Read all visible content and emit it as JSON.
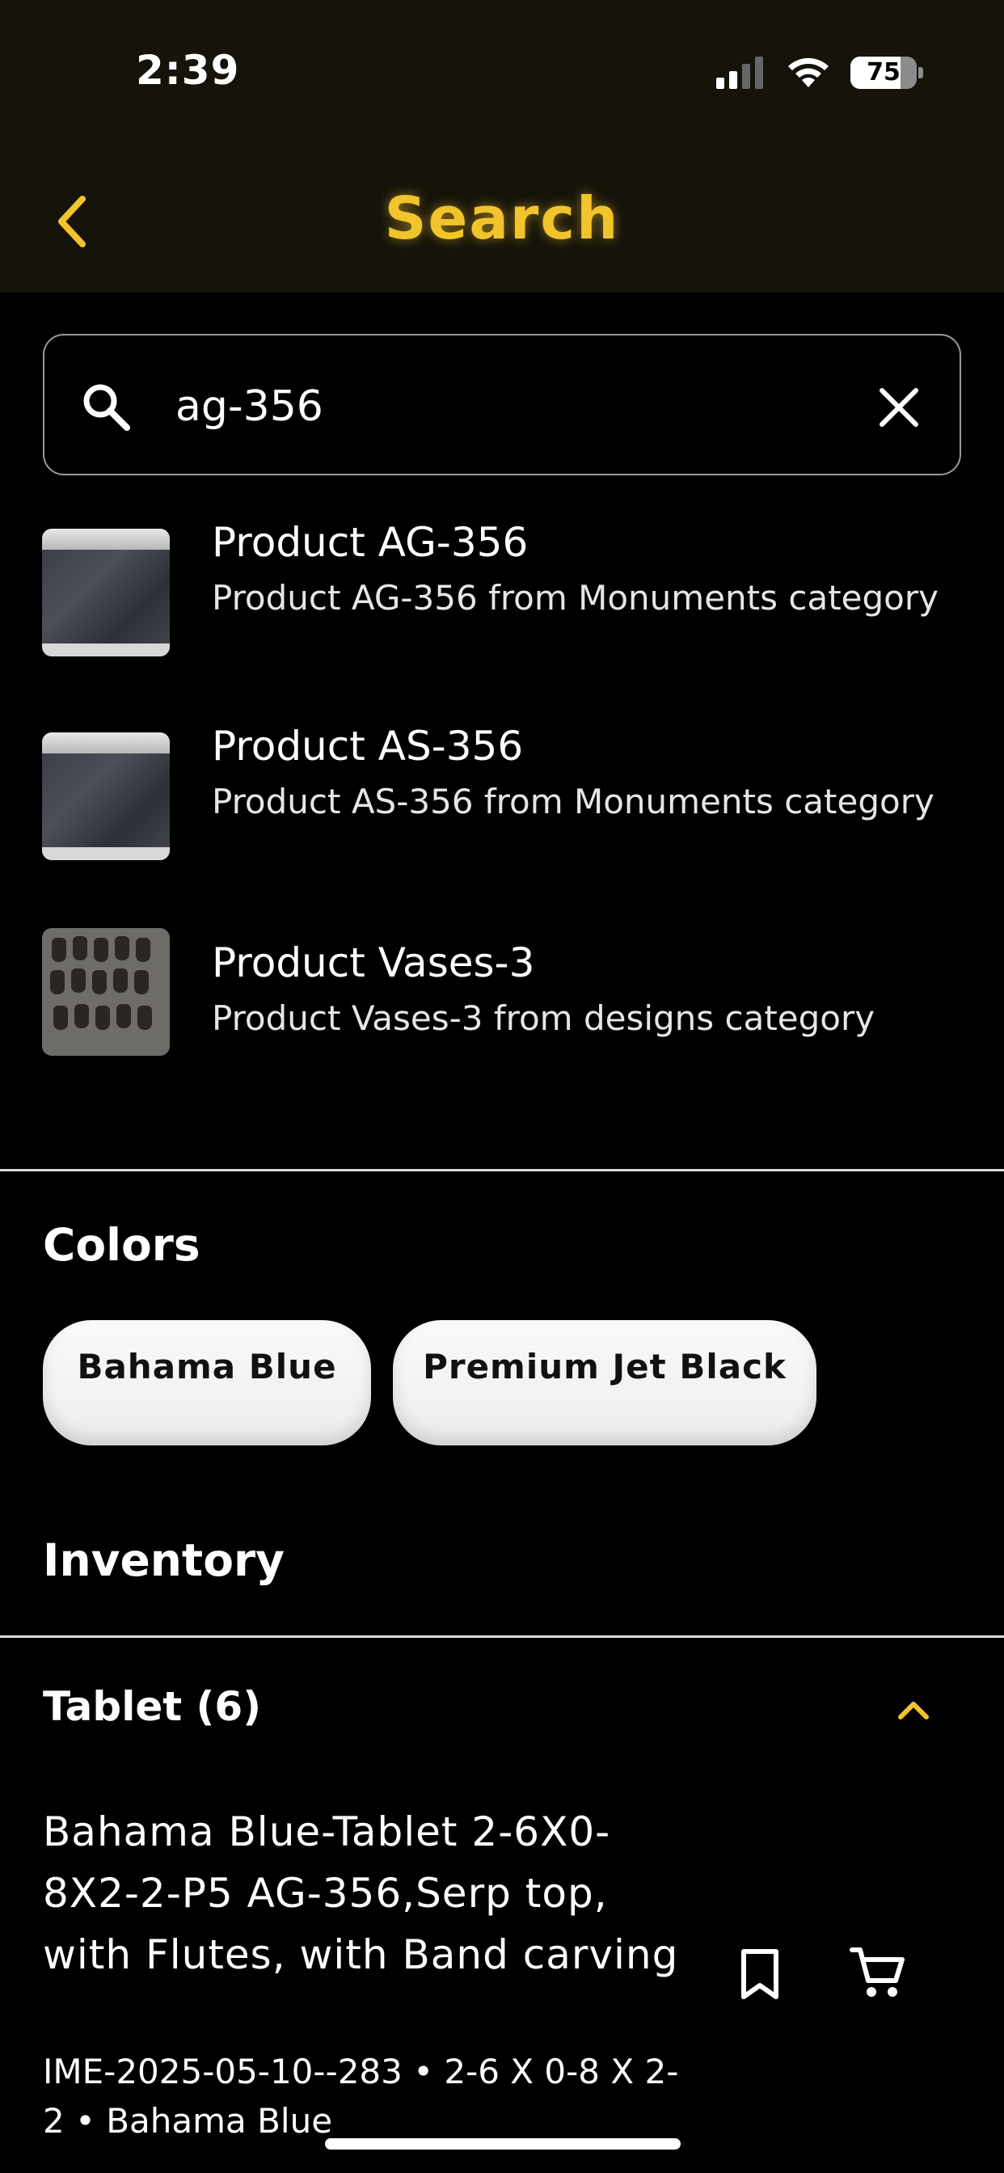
{
  "status_bar": {
    "time": "2:39",
    "battery": "75",
    "battery_level_percent": 75
  },
  "header": {
    "title": "Search",
    "back_icon": "chevron-left-icon",
    "accent_color": "#f2c42b"
  },
  "search": {
    "value": "ag-356",
    "search_icon": "search-icon",
    "clear_icon": "close-icon"
  },
  "results": [
    {
      "title": "Product AG-356",
      "description": "Product AG-356 from Monuments category"
    },
    {
      "title": "Product AS-356",
      "description": "Product AS-356 from Monuments category"
    },
    {
      "title": "Product Vases-3",
      "description": "Product Vases-3 from designs category"
    }
  ],
  "colors": {
    "heading": "Colors",
    "chips": [
      "Bahama Blue",
      "Premium Jet Black"
    ]
  },
  "inventory": {
    "heading": "Inventory",
    "group_title": "Tablet (6)",
    "item": {
      "title": "Bahama Blue-Tablet 2-6X0-8X2-2-P5 AG-356,Serp top, with Flutes, with Band carving",
      "meta": "IME-2025-05-10--283 • 2-6 X 0-8 X 2-2 • Bahama Blue"
    }
  }
}
